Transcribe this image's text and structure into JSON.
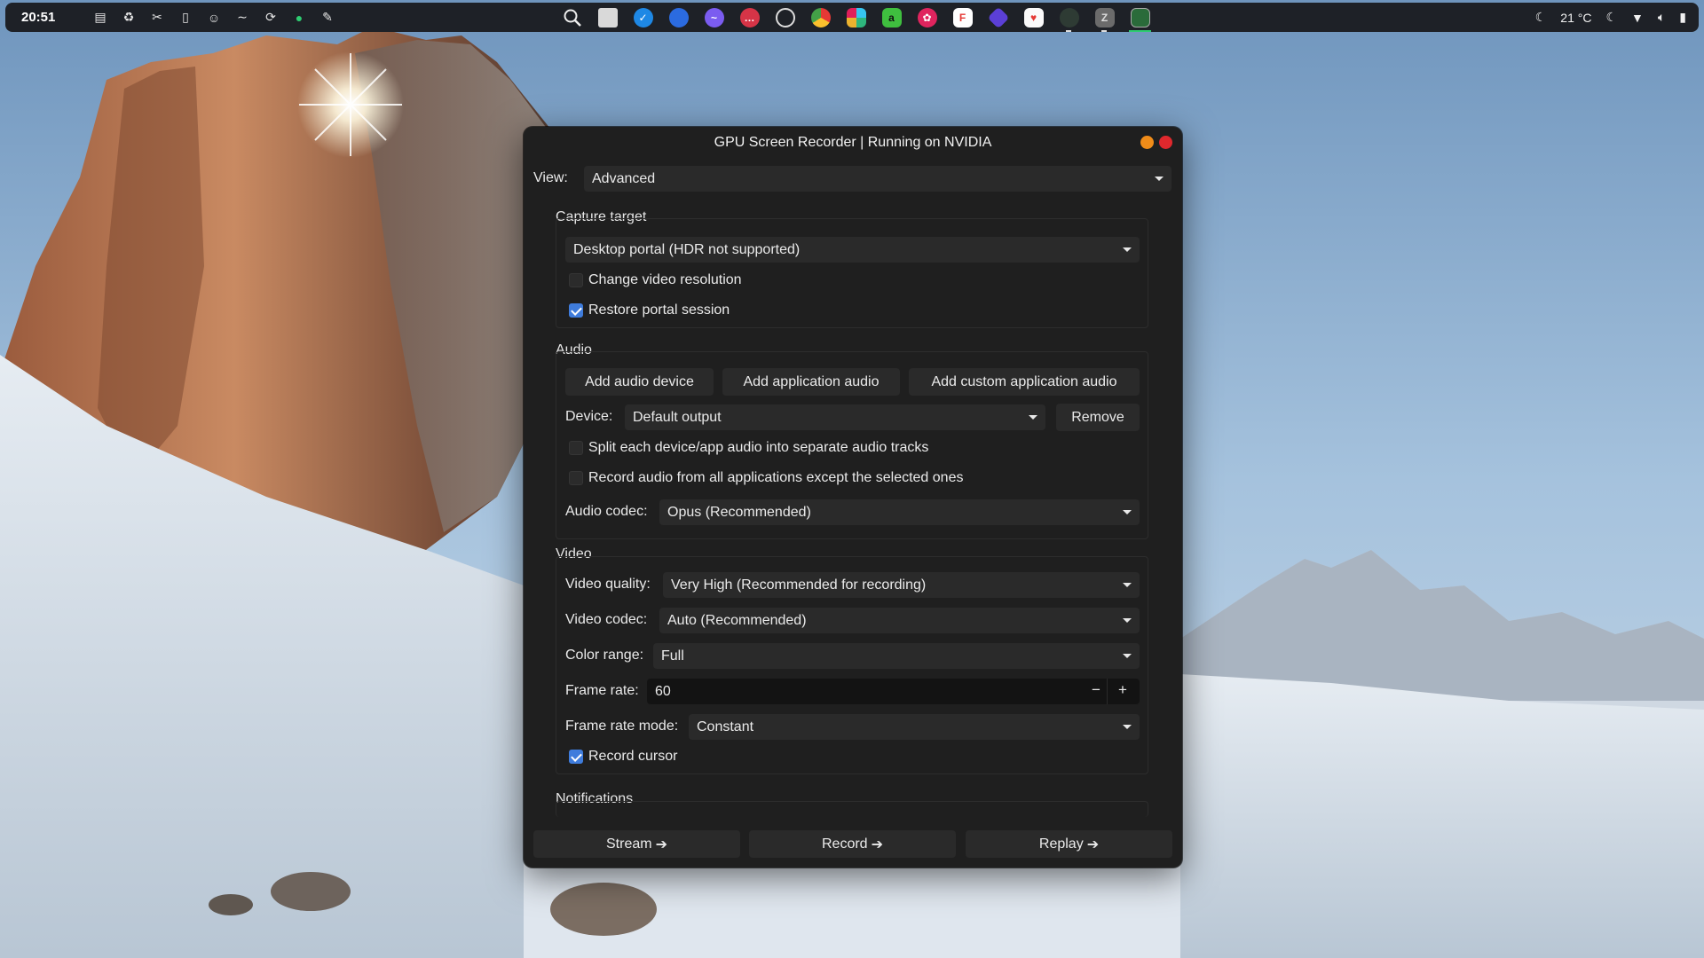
{
  "topbar": {
    "clock": "20:51",
    "weather": "21 °C",
    "tray_left_icons": [
      "monitor-icon",
      "recycle-icon",
      "tools-icon",
      "tablet-icon",
      "user-icon",
      "wave-icon",
      "sync-icon",
      "spotify-icon",
      "patch-icon"
    ],
    "dock_apps": [
      "search-icon",
      "files-icon",
      "browser-icon",
      "firefox-icon",
      "messenger-icon",
      "chat-icon",
      "obs-icon",
      "chrome-icon",
      "slack-icon",
      "notes-icon",
      "disk-icon",
      "flathub-icon",
      "kdenlive-icon",
      "cards-icon",
      "record-icon",
      "zim-icon",
      "gpu-recorder-icon"
    ],
    "tray_right_icons": [
      "night-icon",
      "moon-icon",
      "wifi-icon",
      "volume-icon",
      "battery-icon"
    ]
  },
  "window": {
    "title": "GPU Screen Recorder | Running on NVIDIA",
    "view_label": "View:",
    "view_value": "Advanced",
    "capture": {
      "title": "Capture target",
      "target_value": "Desktop portal (HDR not supported)",
      "change_resolution_label": "Change video resolution",
      "change_resolution_checked": false,
      "restore_session_label": "Restore portal session",
      "restore_session_checked": true
    },
    "audio": {
      "title": "Audio",
      "add_device": "Add audio device",
      "add_app": "Add application audio",
      "add_custom": "Add custom application audio",
      "device_label": "Device:",
      "device_value": "Default output",
      "remove": "Remove",
      "split_label": "Split each device/app audio into separate audio tracks",
      "split_checked": false,
      "record_all_label": "Record audio from all applications except the selected ones",
      "record_all_checked": false,
      "codec_label": "Audio codec:",
      "codec_value": "Opus (Recommended)"
    },
    "video": {
      "title": "Video",
      "quality_label": "Video quality:",
      "quality_value": "Very High (Recommended for recording)",
      "codec_label": "Video codec:",
      "codec_value": "Auto (Recommended)",
      "range_label": "Color range:",
      "range_value": "Full",
      "fps_label": "Frame rate:",
      "fps_value": "60",
      "fps_minus": "−",
      "fps_plus": "+",
      "fps_mode_label": "Frame rate mode:",
      "fps_mode_value": "Constant",
      "cursor_label": "Record cursor",
      "cursor_checked": true
    },
    "notifications": {
      "title": "Notifications"
    },
    "footer": {
      "stream": "Stream",
      "record": "Record",
      "replay": "Replay",
      "arrow": "➔"
    }
  },
  "colors": {
    "accent": "#3f7cdc",
    "minimize": "#f08c19",
    "close": "#e0282d",
    "window_bg": "#1f1f1f",
    "control_bg": "#2a2a2a"
  }
}
